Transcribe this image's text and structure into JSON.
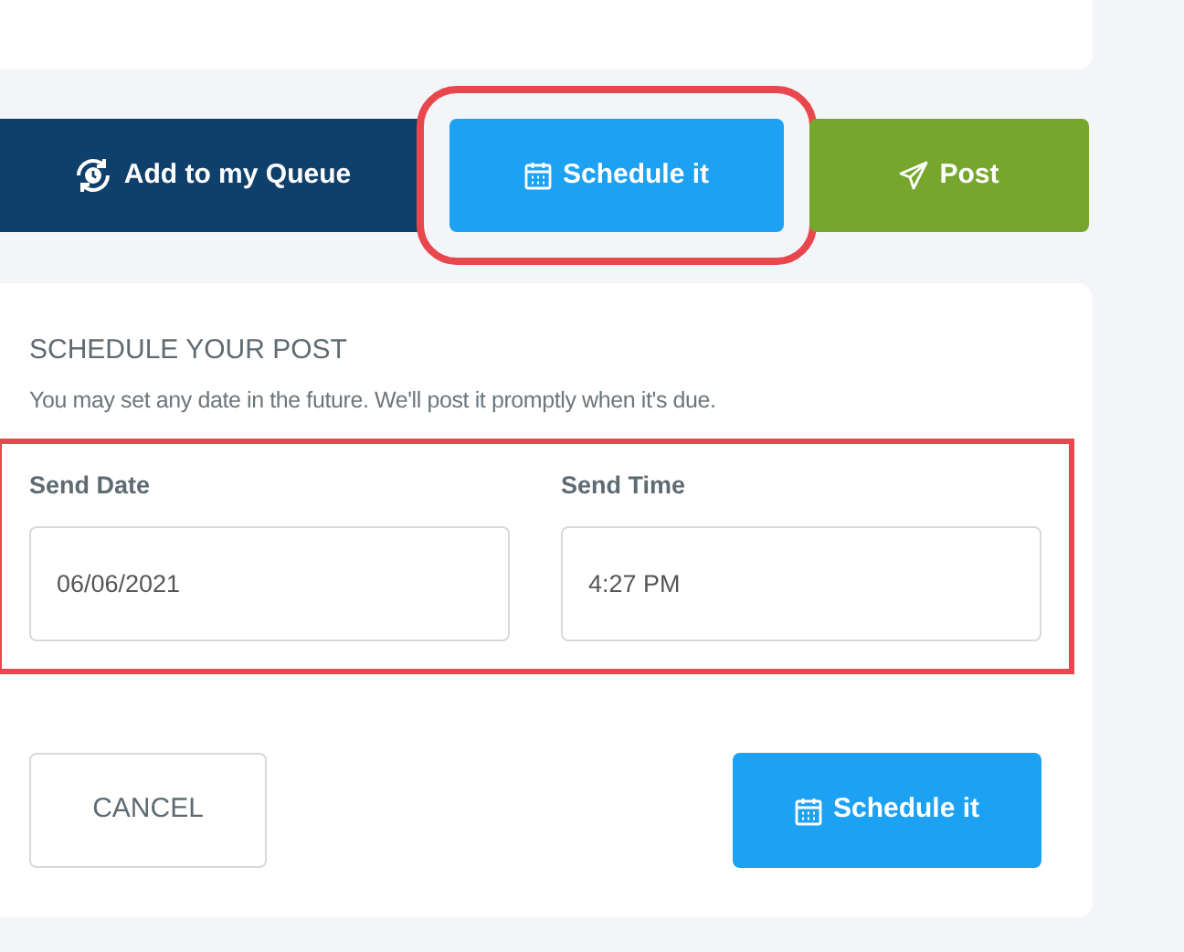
{
  "actions": [
    {
      "kind": "queue",
      "label": "Add to my Queue",
      "highlighted": false
    },
    {
      "kind": "schedule",
      "label": "Schedule it",
      "highlighted": true
    },
    {
      "kind": "post",
      "label": "Post",
      "highlighted": false
    }
  ],
  "schedule_panel": {
    "title": "SCHEDULE YOUR POST",
    "description": "You may set any date in the future. We'll post it promptly when it's due.",
    "fields_highlighted": true,
    "fields": [
      {
        "label": "Send Date",
        "value": "06/06/2021"
      },
      {
        "label": "Send Time",
        "value": "4:27 PM"
      }
    ],
    "buttons": [
      {
        "kind": "cancel",
        "label": "CANCEL"
      },
      {
        "kind": "schedule",
        "label": "Schedule it"
      }
    ]
  }
}
